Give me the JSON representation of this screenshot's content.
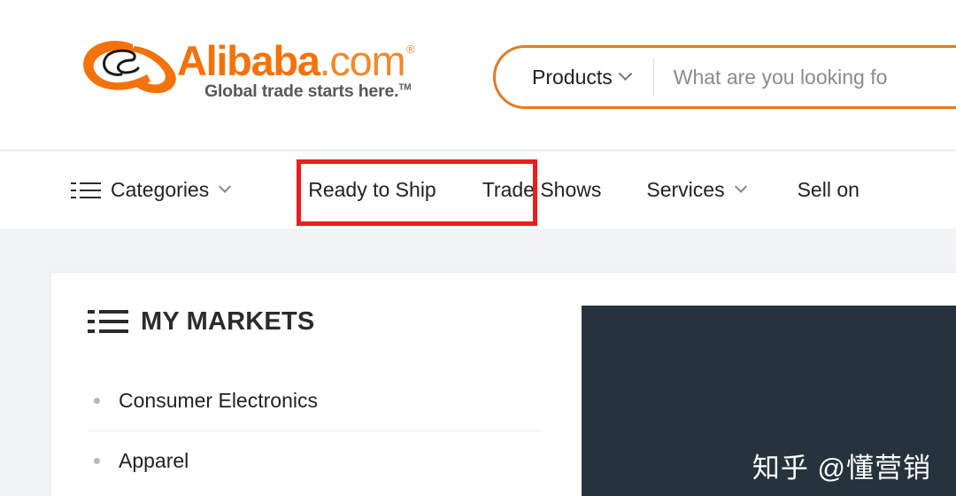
{
  "header": {
    "logo": {
      "brand_main": "Alibaba",
      "brand_suffix": ".com",
      "registered_mark": "®",
      "tagline": "Global trade starts here.",
      "trademark_mark": "TM",
      "brand_color": "#f4720b"
    },
    "search": {
      "category_label": "Products",
      "category_chevron_icon": "chevron-down-icon",
      "placeholder": "What are you looking fo",
      "value": "",
      "border_color": "#e07b26"
    }
  },
  "nav": {
    "categories": {
      "label": "Categories",
      "icon": "list-icon",
      "chevron_icon": "chevron-down-icon"
    },
    "items": [
      {
        "label": "Ready to Ship",
        "has_chevron": false,
        "highlighted": true
      },
      {
        "label": "Trade Shows",
        "has_chevron": false,
        "highlighted": false
      },
      {
        "label": "Services",
        "has_chevron": true,
        "highlighted": false
      },
      {
        "label": "Sell on",
        "has_chevron": false,
        "highlighted": false
      }
    ],
    "highlight_color": "#ee1c1c"
  },
  "main": {
    "markets": {
      "title": "MY MARKETS",
      "icon": "list-icon",
      "rows": [
        {
          "label": "Consumer Electronics"
        },
        {
          "label": "Apparel"
        }
      ]
    },
    "banner": {
      "background_color": "#24333c",
      "watermark": "知乎 @懂营销"
    }
  }
}
